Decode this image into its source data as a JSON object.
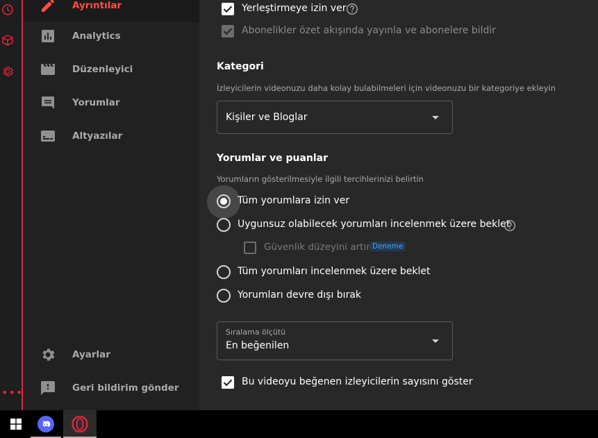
{
  "nav": {
    "items": [
      {
        "label": "Ayrıntılar",
        "icon": "pencil-icon",
        "active": true
      },
      {
        "label": "Analytics",
        "icon": "analytics-icon"
      },
      {
        "label": "Düzenleyici",
        "icon": "editor-clapper-icon"
      },
      {
        "label": "Yorumlar",
        "icon": "comments-icon"
      },
      {
        "label": "Altyazılar",
        "icon": "subtitles-icon"
      }
    ],
    "bottom": [
      {
        "label": "Ayarlar",
        "icon": "gear-icon"
      },
      {
        "label": "Geri bildirim gönder",
        "icon": "feedback-icon"
      }
    ]
  },
  "options": {
    "embed_label": "Yerleştirmeye izin ver",
    "subscriptions_label": "Abonelikler özet akışında yayınla ve abonelere bildir"
  },
  "category": {
    "title": "Kategori",
    "description": "İzleyicilerin videonuzu daha kolay bulabilmeleri için videonuzu bir kategoriye ekleyin",
    "selected": "Kişiler ve Bloglar"
  },
  "comments": {
    "title": "Yorumlar ve puanlar",
    "description": "Yorumların gösterilmesiyle ilgili tercihlerinizi belirtin",
    "radios": [
      {
        "label": "Tüm yorumlara izin ver",
        "selected": true
      },
      {
        "label": "Uygunsuz olabilecek yorumları incelenmek üzere beklet",
        "selected": false
      },
      {
        "label": "Tüm yorumları incelenmek üzere beklet",
        "selected": false
      },
      {
        "label": "Yorumları devre dışı bırak",
        "selected": false
      }
    ],
    "strict_label": "Güvenlik düzeyini artır",
    "strict_badge": "Deneme",
    "sort_label": "Sıralama ölçütü",
    "sort_value": "En beğenilen",
    "show_likes_label": "Bu videoyu beğenen izleyicilerin sayısını göster"
  },
  "colors": {
    "accent": "#ff4e45",
    "opera_red": "#e0263d",
    "discord": "#5865f2",
    "link_blue": "#3ea6ff"
  }
}
